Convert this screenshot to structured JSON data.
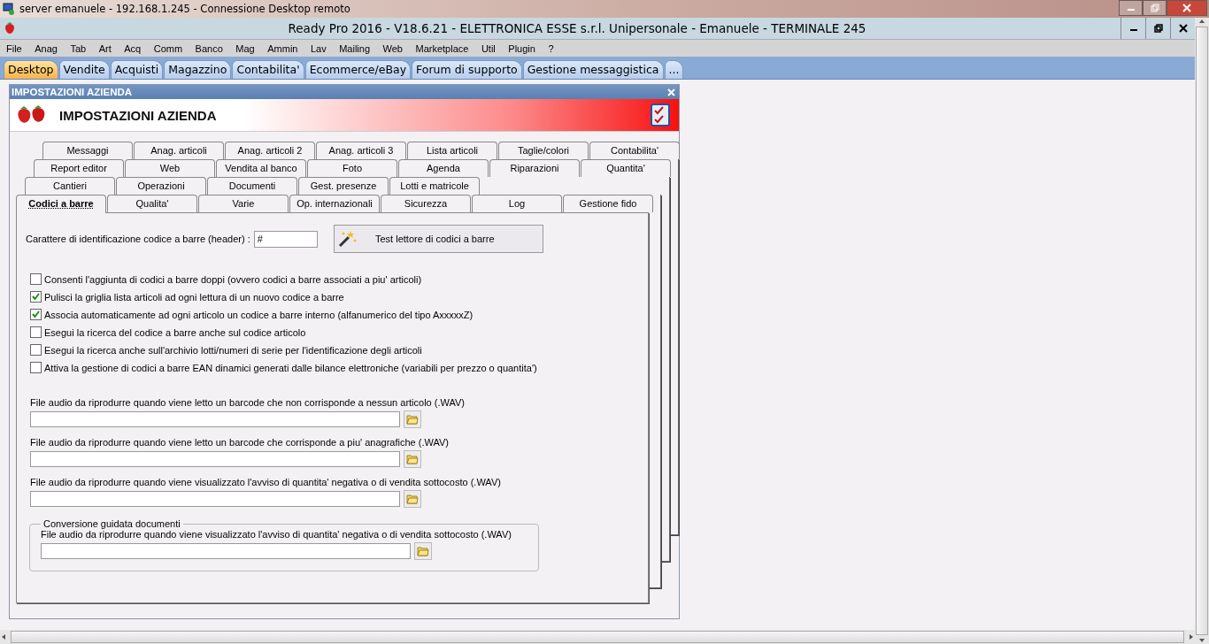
{
  "rdp_window": {
    "title": "server emanuele - 192.168.1.245 - Connessione Desktop remoto"
  },
  "app": {
    "title": "Ready Pro 2016 - V18.6.21 - ELETTRONICA ESSE s.r.l. Unipersonale - Emanuele - TERMINALE 245"
  },
  "menu": [
    "File",
    "Anag",
    "Tab",
    "Art",
    "Acq",
    "Comm",
    "Banco",
    "Mag",
    "Ammin",
    "Lav",
    "Mailing",
    "Web",
    "Marketplace",
    "Util",
    "Plugin",
    "?"
  ],
  "app_tabs": [
    {
      "label": "Desktop",
      "selected": true
    },
    {
      "label": "Vendite",
      "selected": false
    },
    {
      "label": "Acquisti",
      "selected": false
    },
    {
      "label": "Magazzino",
      "selected": false
    },
    {
      "label": "Contabilita'",
      "selected": false
    },
    {
      "label": "Ecommerce/eBay",
      "selected": false
    },
    {
      "label": "Forum di supporto",
      "selected": false
    },
    {
      "label": "Gestione messaggistica",
      "selected": false
    },
    {
      "label": "...",
      "selected": false
    }
  ],
  "panel": {
    "title": "IMPOSTAZIONI AZIENDA",
    "header_title": "IMPOSTAZIONI AZIENDA"
  },
  "settings_tabs": [
    [
      {
        "label": "Messaggi",
        "selected": false
      },
      {
        "label": "Anag. articoli",
        "selected": false
      },
      {
        "label": "Anag. articoli 2",
        "selected": false
      },
      {
        "label": "Anag. articoli 3",
        "selected": false
      },
      {
        "label": "Lista articoli",
        "selected": false
      },
      {
        "label": "Taglie/colori",
        "selected": false
      },
      {
        "label": "Contabilita'",
        "selected": false
      }
    ],
    [
      {
        "label": "Report editor",
        "selected": false
      },
      {
        "label": "Web",
        "selected": false
      },
      {
        "label": "Vendita al banco",
        "selected": false
      },
      {
        "label": "Foto",
        "selected": false
      },
      {
        "label": "Agenda",
        "selected": false
      },
      {
        "label": "Riparazioni",
        "selected": false
      },
      {
        "label": "Quantita'",
        "selected": false
      }
    ],
    [
      {
        "label": "Cantieri",
        "selected": false
      },
      {
        "label": "Operazioni",
        "selected": false
      },
      {
        "label": "Documenti",
        "selected": false
      },
      {
        "label": "Gest. presenze",
        "selected": false
      },
      {
        "label": "Lotti e matricole",
        "selected": false
      }
    ],
    [
      {
        "label": "Codici a barre",
        "selected": true
      },
      {
        "label": "Qualita'",
        "selected": false
      },
      {
        "label": "Varie",
        "selected": false
      },
      {
        "label": "Op. internazionali",
        "selected": false
      },
      {
        "label": "Sicurezza",
        "selected": false
      },
      {
        "label": "Log",
        "selected": false
      },
      {
        "label": "Gestione fido",
        "selected": false
      }
    ]
  ],
  "barcode_header": {
    "label": "Carattere di identificazione codice a barre (header) :",
    "value": "#"
  },
  "test_button": {
    "label": "Test lettore di codici a barre"
  },
  "checkboxes": [
    {
      "label": "Consenti l'aggiunta di codici a barre doppi (ovvero codici a barre associati a piu' articoli)",
      "checked": false
    },
    {
      "label": "Pulisci la griglia lista articoli ad ogni lettura di un nuovo codice a barre",
      "checked": true
    },
    {
      "label": "Associa automaticamente ad ogni articolo un codice a barre interno (alfanumerico del tipo AxxxxxZ)",
      "checked": true
    },
    {
      "label": "Esegui la ricerca del codice a barre anche sul codice articolo",
      "checked": false
    },
    {
      "label": "Esegui la ricerca anche sull'archivio lotti/numeri di serie per l'identificazione degli articoli",
      "checked": false
    },
    {
      "label": "Attiva la gestione di codici a barre EAN dinamici generati dalle bilance elettroniche (variabili per prezzo o quantita')",
      "checked": false
    }
  ],
  "audio_files": [
    {
      "label": "File audio da riprodurre quando viene letto un barcode che non corrisponde a nessun articolo (.WAV)"
    },
    {
      "label": "File audio da riprodurre quando viene letto un barcode che corrisponde a piu' anagrafiche (.WAV)"
    },
    {
      "label": "File audio da riprodurre quando viene visualizzato l'avviso di quantita' negativa o di vendita sottocosto (.WAV)"
    }
  ],
  "group": {
    "title": "Conversione guidata documenti",
    "audio_files": [
      {
        "label": "File audio da riprodurre quando viene visualizzato l'avviso di quantita' negativa o di vendita sottocosto (.WAV)"
      }
    ]
  }
}
